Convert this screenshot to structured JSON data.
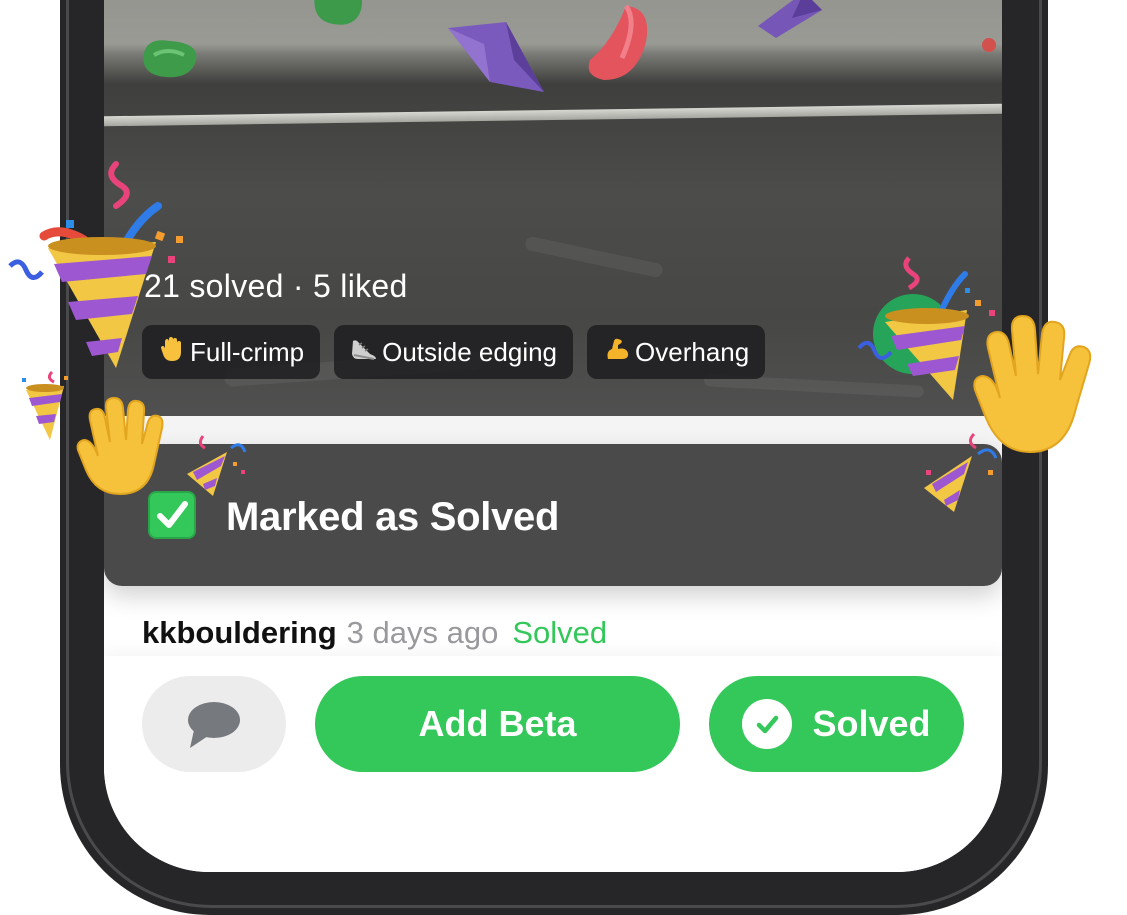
{
  "problem": {
    "stats": "21 solved · 5 liked",
    "tags": [
      {
        "icon": "waving-hand-icon",
        "label": "Full-crimp"
      },
      {
        "icon": "shoe-icon",
        "label": "Outside edging"
      },
      {
        "icon": "flexed-biceps-icon",
        "label": "Overhang"
      }
    ]
  },
  "toast": {
    "icon": "check-mark-button-icon",
    "text": "Marked as Solved"
  },
  "activity": {
    "username": "kkbouldering",
    "time": "3 days ago",
    "status": "Solved"
  },
  "actions": {
    "comment_icon": "speech-bubble-icon",
    "add_beta_label": "Add Beta",
    "solved_label": "Solved"
  },
  "colors": {
    "accent_green": "#34c759",
    "toast_bg": "#4a4a4a",
    "phone_frame": "#262628",
    "comment_button_bg": "#ececed"
  },
  "decorations": [
    "party-popper-icon",
    "raised-hand-icon"
  ]
}
